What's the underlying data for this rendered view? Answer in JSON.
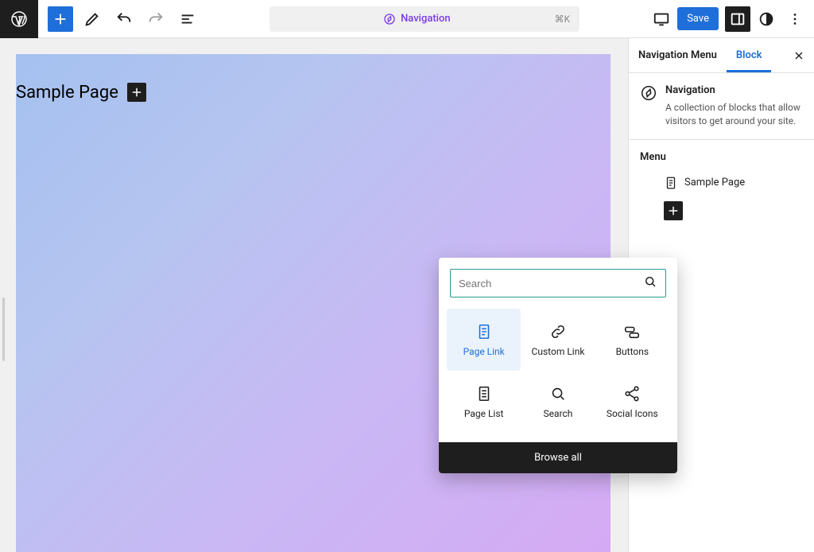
{
  "topbar": {
    "doc_title": "Navigation",
    "kbd": "⌘K",
    "save_label": "Save"
  },
  "canvas": {
    "page_link_text": "Sample Page"
  },
  "inserter": {
    "search_placeholder": "Search",
    "blocks": {
      "page_link": "Page Link",
      "custom_link": "Custom Link",
      "buttons": "Buttons",
      "page_list": "Page List",
      "search": "Search",
      "social_icons": "Social Icons"
    },
    "browse_all": "Browse all"
  },
  "sidebar": {
    "tab_nav": "Navigation Menu",
    "tab_block": "Block",
    "block_title": "Navigation",
    "block_desc": "A collection of blocks that allow visitors to get around your site.",
    "menu_section": "Menu",
    "menu_item_1": "Sample Page"
  }
}
